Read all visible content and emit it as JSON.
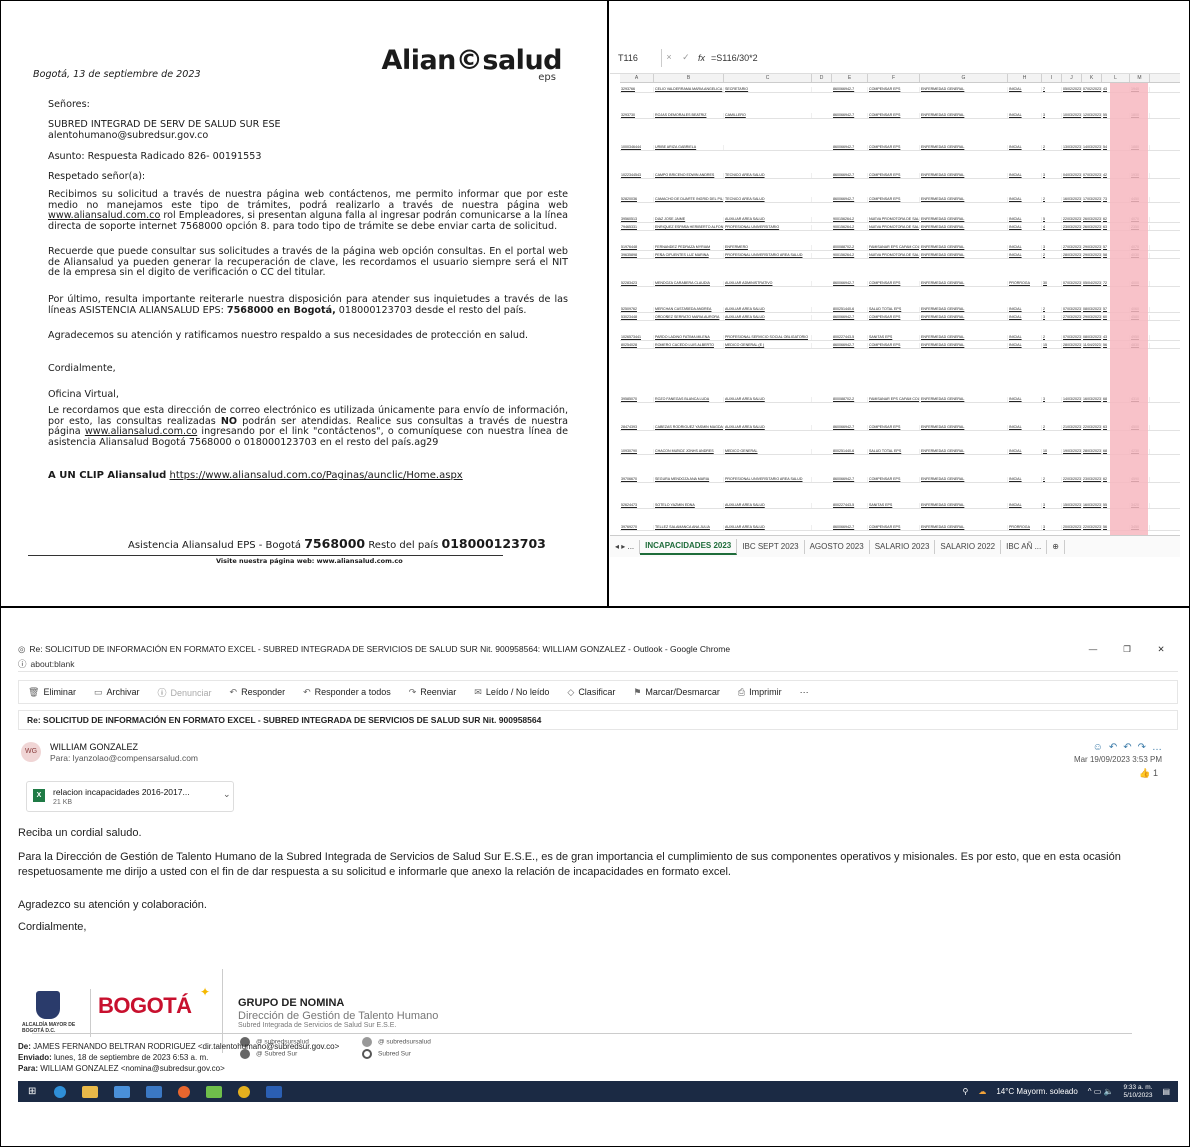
{
  "letter": {
    "logo_text": "Alian©salud",
    "logo_sub": "eps",
    "date": "Bogotá, 13 de septiembre de 2023",
    "salutation": "Señores:",
    "recipient_name": "SUBRED INTEGRAD DE SERV DE SALUD SUR ESE",
    "recipient_email": "alentohumano@subredsur.gov.co",
    "subject": "Asunto: Respuesta Radicado 826- 00191553",
    "greeting": "Respetado señor(a):",
    "para1_a": "Recibimos su solicitud a través de nuestra página web contáctenos, me permito informar que por este medio no manejamos este tipo de trámites, podrá realizarlo a través de nuestra página web",
    "para1_link": "www.aliansalud.com.co",
    "para1_b": "rol Empleadores, si presentan alguna falla al ingresar podrán comunicarse a la línea directa de soporte internet 7568000 opción 8. para todo tipo de trámite se debe enviar carta de solicitud.",
    "para2": "Recuerde que puede consultar sus solicitudes a través de la página web opción consultas. En el portal web de Aliansalud ya pueden generar la recuperación de clave, les recordamos el usuario siempre será el NIT de la empresa sin el digito de verificación o CC del titular.",
    "para3_a": "Por último, resulta importante reiterarle nuestra disposición para atender sus inquietudes a través de las líneas ASISTENCIA ALIANSALUD EPS:",
    "para3_bold": "7568000 en Bogotá,",
    "para3_b": "018000123703 desde el resto del país.",
    "para4": "Agradecemos su atención y ratificamos nuestro respaldo a sus necesidades de protección en salud.",
    "closing": "Cordialmente,",
    "office": "Oficina Virtual,",
    "para5_a": "Le recordamos que esta dirección de correo electrónico es utilizada únicamente para envío de información, por esto, las consultas realizadas",
    "para5_bold": "NO",
    "para5_b": "podrán ser atendidas. Realice sus consultas a través de nuestra página",
    "para5_link": "www.aliansalud.com.co",
    "para5_c": "ingresando por el link \"contáctenos\", o comuníquese con nuestra línea de asistencia Aliansalud Bogotá 7568000 o 018000123703 en el resto del país.ag29",
    "clip_label": "A UN CLIP Aliansalud",
    "clip_link": "https://www.aliansalud.com.co/Paginas/aunclic/Home.aspx",
    "footer_a": "Asistencia Aliansalud EPS - Bogotá",
    "footer_phone": "7568000",
    "footer_b": "Resto del país",
    "footer_phone2": "018000123703",
    "footer_visit": "Visite nuestra página web: www.aliansalud.com.co"
  },
  "sheet": {
    "cell_ref": "T116",
    "formula": "=S116/30*2",
    "columns": [
      "A",
      "B",
      "C",
      "D",
      "E",
      "F",
      "G",
      "H",
      "I",
      "J",
      "K",
      "L",
      "M"
    ],
    "rows": [
      {
        "n": "35",
        "c": [
          "3293766",
          "CELIO VALDERRAMA MARIA ANGELICA",
          "SECRETARIO",
          "",
          "860066942-7",
          "COMPENSAR EPS",
          "ENFERMEDAD GENERAL",
          "INICIAL",
          "7",
          "05/02/2023",
          "07/02/2023",
          "43",
          "1940"
        ]
      },
      {
        "n": "36",
        "c": [
          "3293730",
          "ROJAS DEMORALES BEATRIZ",
          "CAMILLERO",
          "",
          "860066942-7",
          "COMPENSAR EPS",
          "ENFERMEDAD GENERAL",
          "INICIAL",
          "3",
          "10/03/2023",
          "12/03/2023",
          "55",
          "1800"
        ]
      },
      {
        "n": "38",
        "c": [
          "1000346444",
          "URIBE ARIZA GABRIELA",
          "",
          "",
          "860066942-7",
          "COMPENSAR EPS",
          "ENFERMEDAD GENERAL",
          "INICIAL",
          "2",
          "13/03/2023",
          "14/03/2023",
          "54",
          "1880"
        ]
      },
      {
        "n": "40",
        "c": [
          "1022344543",
          "CAMPO BRICENO EDWIN ANDRES",
          "TECNICO AREA SALUD",
          "",
          "860066942-7",
          "COMPENSAR EPS",
          "ENFERMEDAD GENERAL",
          "INICIAL",
          "3",
          "04/03/2023",
          "07/03/2023",
          "42",
          "1930"
        ]
      },
      {
        "n": "42",
        "c": [
          "52820036",
          "CAMACHO DE DUARTE INGRID DEL PILAR",
          "TECNICO AREA SALUD",
          "",
          "860066942-7",
          "COMPENSAR EPS",
          "ENFERMEDAD GENERAL",
          "INICIAL",
          "2",
          "16/03/2023",
          "17/03/2023",
          "73",
          "4450"
        ]
      },
      {
        "n": "43",
        "c": [
          "39560513",
          "DIAZ JOSE JAIME",
          "AUXILIAR AREA SALUD",
          "",
          "900156264-2",
          "NUEVA PROMOTORA DE SALUD",
          "ENFERMEDAD GENERAL",
          "INICIAL",
          "5",
          "22/03/2023",
          "26/03/2023",
          "62",
          "4070"
        ]
      },
      {
        "n": "44",
        "c": [
          "79465331",
          "ENRIQUEZ ESPAÑA HERIBERTO ALFONSO",
          "PROFESIONAL UNIVERSITARIO",
          "",
          "900156264-2",
          "NUEVA PROMOTORA DE SALUD",
          "ENFERMEDAD GENERAL",
          "INICIAL",
          "4",
          "23/03/2023",
          "26/03/2023",
          "63",
          "2350"
        ]
      },
      {
        "n": "45",
        "c": [
          "51976448",
          "FERNANDEZ PEDRAZA MYRIAM",
          "ENFERMERO",
          "",
          "800088702-2",
          "FAMISANAR EPS CAFAM COLSUBSIDIO",
          "ENFERMEDAD GENERAL",
          "INICIAL",
          "3",
          "27/03/2023",
          "29/03/2023",
          "57",
          "4070"
        ]
      },
      {
        "n": "46",
        "c": [
          "39635898",
          "PEÑA CIFUENTES LUZ MARINA",
          "PROFESIONAL UNIVERSITARIO AREA SALUD",
          "",
          "900156264-2",
          "NUEVA PROMOTORA DE SALUD",
          "ENFERMEDAD GENERAL",
          "INICIAL",
          "2",
          "28/03/2023",
          "29/03/2023",
          "58",
          "4030"
        ]
      },
      {
        "n": "47",
        "c": [
          "52283423",
          "MENDOZA CARABERA CLAUDIA",
          "AUXILIAR ADMINISTRATIVO",
          "",
          "860066942-7",
          "COMPENSAR EPS",
          "ENFERMEDAD GENERAL",
          "PRÓRROGA",
          "30",
          "07/03/2023",
          "05/04/2023",
          "72",
          "4000"
        ]
      },
      {
        "n": "48",
        "c": [
          "52509762",
          "MERCHAN CASTAÑEDA ANDREA",
          "AUXILIAR AREA SALUD",
          "",
          "800251440-6",
          "SALUD TOTAL EPS",
          "ENFERMEDAD GENERAL",
          "INICIAL",
          "2",
          "07/03/2023",
          "08/03/2023",
          "57",
          "4060"
        ]
      },
      {
        "n": "49",
        "c": [
          "53023448",
          "ORDOÑEZ SERRATO MARIA AURORA",
          "AUXILIAR AREA SALUD",
          "",
          "860066942-7",
          "COMPENSAR EPS",
          "ENFERMEDAD GENERAL",
          "INICIAL",
          "3",
          "27/03/2023",
          "29/03/2023",
          "60",
          "4580"
        ]
      },
      {
        "n": "50",
        "c": [
          "1026573441",
          "PARDO LADINO FATIMA MILENA",
          "PROFESIONAL SERVICIO SOCIAL OBLIGATORIO",
          "",
          "800227443-5",
          "SANITAS EPS",
          "ENFERMEDAD GENERAL",
          "INICIAL",
          "2",
          "07/03/2023",
          "08/03/2023",
          "43",
          "4950"
        ]
      },
      {
        "n": "51",
        "c": [
          "80254028",
          "ROMERO CACEDO LUIS ALBERTO",
          "MEDICO GENERAL (E )",
          "",
          "860066942-7",
          "COMPENSAR EPS",
          "ENFERMEDAD GENERAL",
          "INICIAL",
          "15",
          "28/03/2023",
          "11/04/2023",
          "56",
          "4830"
        ]
      },
      {
        "n": "52",
        "c": [
          "39585070",
          "ROZO FANEGAS BLANCA LUDA",
          "AUXILIAR AREA SALUD",
          "",
          "800088702-2",
          "FAMISANAR EPS CAFAM COLSUBSIDIO",
          "ENFERMEDAD GENERAL",
          "INICIAL",
          "3",
          "14/03/2023",
          "16/03/2023",
          "68",
          "4310"
        ]
      },
      {
        "n": "53",
        "c": [
          "28474393",
          "CABEZAS RODRIGUEZ YASMIN MAGDALENA",
          "AUXILIAR AREA SALUD",
          "",
          "860066942-7",
          "COMPENSAR EPS",
          "ENFERMEDAD GENERAL",
          "INICIAL",
          "2",
          "21/03/2023",
          "22/03/2023",
          "63",
          "4500"
        ]
      },
      {
        "n": "54",
        "c": [
          "10930790",
          "CHACON MUÑOZ JONHS ANDRES",
          "MEDICO GENERAL",
          "",
          "800251440-6",
          "SALUD TOTAL EPS",
          "ENFERMEDAD GENERAL",
          "INICIAL",
          "10",
          "19/03/2023",
          "28/03/2023",
          "68",
          "4230"
        ]
      },
      {
        "n": "55",
        "c": [
          "39706670",
          "SEGURA MENDOZA ANA MARIA",
          "PROFESIONAL UNIVERSITARIO AREA SALUD",
          "",
          "860066942-7",
          "COMPENSAR EPS",
          "ENFERMEDAD GENERAL",
          "INICIAL",
          "2",
          "22/03/2023",
          "23/03/2023",
          "62",
          "4590"
        ]
      },
      {
        "n": "56",
        "c": [
          "52624473",
          "SOTELO YAZMIN EDNA",
          "AUXILIAR AREA SALUD",
          "",
          "800227443-5",
          "SANITAS EPS",
          "ENFERMEDAD GENERAL",
          "INICIAL",
          "3",
          "15/03/2023",
          "16/03/2023",
          "55",
          "3420"
        ]
      },
      {
        "n": "57",
        "c": [
          "39769270",
          "TELLEZ SALAMANCA ANA JULIA",
          "AUXILIAR AREA SALUD",
          "",
          "860066942-7",
          "COMPENSAR EPS",
          "ENFERMEDAD GENERAL",
          "PRÓRROGA",
          "3",
          "20/03/2023",
          "22/03/2023",
          "56",
          "3450"
        ]
      }
    ],
    "tabs": [
      "INCAPACIDADES 2023",
      "IBC SEPT 2023",
      "AGOSTO 2023",
      "SALARIO 2023",
      "SALARIO 2022",
      "IBC AÑ ..."
    ]
  },
  "outlook": {
    "window_title": "Re: SOLICITUD DE INFORMACIÓN EN FORMATO EXCEL - SUBRED INTEGRADA DE SERVICIOS DE SALUD SUR Nit. 900958564: WILLIAM GONZALEZ - Outlook - Google Chrome",
    "address": "about:blank",
    "toolbar": [
      "Eliminar",
      "Archivar",
      "Denunciar",
      "Responder",
      "Responder a todos",
      "Reenviar",
      "Leído / No leído",
      "Clasificar",
      "Marcar/Desmarcar",
      "Imprimir",
      "···"
    ],
    "subject": "Re: SOLICITUD DE INFORMACIÓN EN FORMATO EXCEL - SUBRED INTEGRADA DE SERVICIOS DE SALUD SUR Nit. 900958564",
    "sender_initials": "WG",
    "sender": "WILLIAM GONZALEZ",
    "to": "Para: lyanzolao@compensarsalud.com",
    "date": "Mar 19/09/2023 3:53 PM",
    "like_count": "1",
    "attachment_name": "relacion incapacidades 2016-2017...",
    "attachment_size": "21 KB",
    "greeting": "Reciba un cordial saludo.",
    "body": "Para la Dirección de Gestión de Talento Humano de la Subred Integrada de Servicios de Salud Sur E.S.E., es de gran importancia el cumplimiento de sus componentes operativos y misionales. Es por esto, que en esta ocasión respetuosamente me dirijo a usted con el fin de dar respuesta a su solicitud e informarle que anexo la relación de incapacidades en formato excel.",
    "thanks": "Agradezco su atención y colaboración.",
    "closing": "Cordialmente,",
    "sig_alcaldia": "ALCALDÍA MAYOR DE BOGOTÁ D.C.",
    "sig_bogota": "BOGOTÁ",
    "sig_group": "GRUPO DE NOMINA",
    "sig_direction": "Dirección de Gestión de Talento Humano",
    "sig_subred": "Subred Integrada de Servicios de Salud Sur E.S.E.",
    "sig_social1": "@ subredsursalud",
    "sig_social2": "@ Subred Sur",
    "sig_social3": "@ subredsursalud",
    "sig_social4": "Subred Sur",
    "fwd_from_label": "De:",
    "fwd_from": "JAMES FERNANDO BELTRAN RODRIGUEZ <dir.talentohumano@subredsur.gov.co>",
    "fwd_sent_label": "Enviado:",
    "fwd_sent": "lunes, 18 de septiembre de 2023 6:53 a. m.",
    "fwd_to_label": "Para:",
    "fwd_to": "WILLIAM GONZALEZ <nomina@subredsur.gov.co>"
  },
  "taskbar": {
    "weather": "14°C  Mayorm. soleado",
    "time": "9:33 a. m.",
    "date": "5/10/2023"
  },
  "colors": {
    "excel_green": "#1e6c3a",
    "highlight_pink": "#f7b7bf",
    "bogota_red": "#c8102e",
    "taskbar": "#1b2a44"
  }
}
